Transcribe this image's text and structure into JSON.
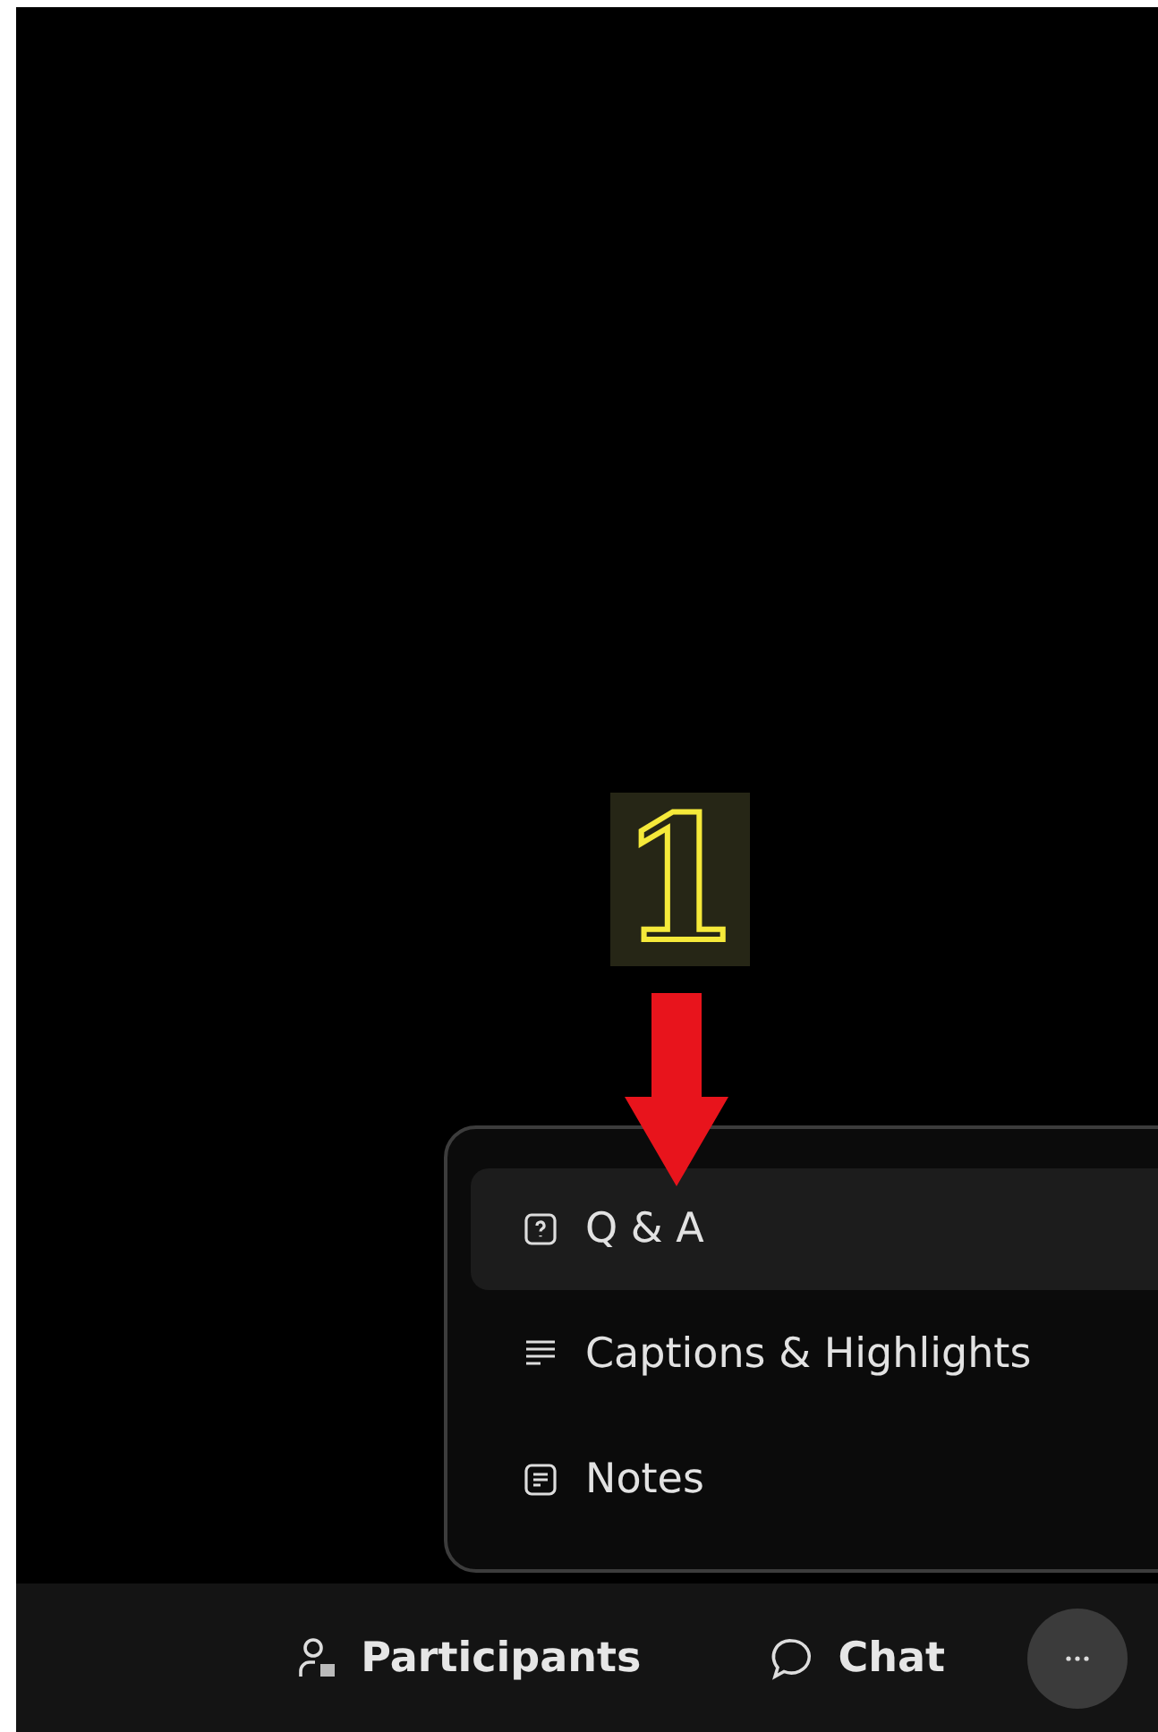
{
  "annotation": {
    "label": "1"
  },
  "more_menu": {
    "items": [
      {
        "kind": "question",
        "label": "Q & A",
        "selected": true
      },
      {
        "kind": "captions",
        "label": "Captions & Highlights",
        "selected": false
      },
      {
        "kind": "notes",
        "label": "Notes",
        "selected": false
      }
    ]
  },
  "toolbar": {
    "buttons": [
      {
        "kind": "participants",
        "label": "Participants"
      },
      {
        "kind": "chat",
        "label": "Chat"
      },
      {
        "kind": "more"
      }
    ]
  }
}
